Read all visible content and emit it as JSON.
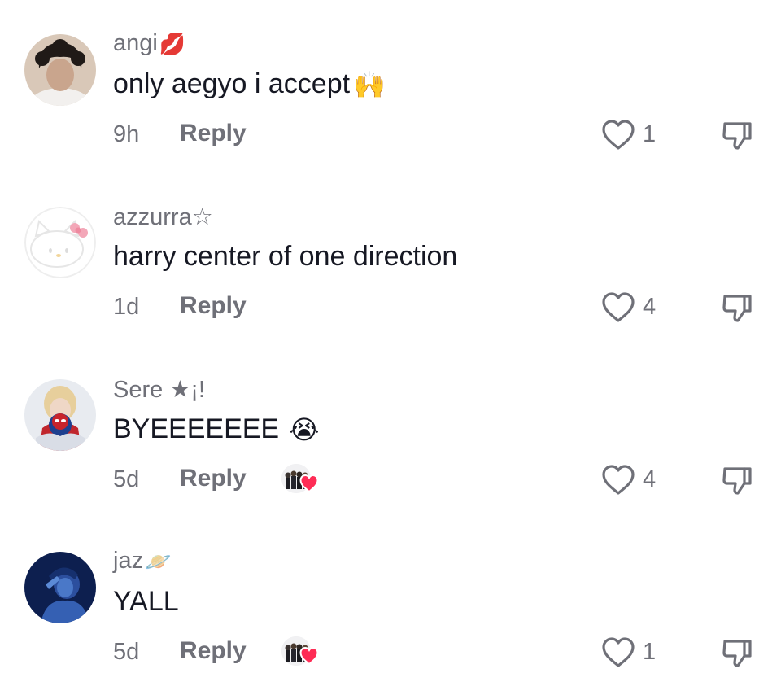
{
  "comments": [
    {
      "username": "angi",
      "username_emoji": "💋",
      "text": "only aegyo i accept",
      "text_emoji": "🙌",
      "time": "9h",
      "reply_label": "Reply",
      "likes": "1",
      "avatar_icon": "person-avatar-icon",
      "creator_liked": false
    },
    {
      "username": "azzurra☆",
      "username_emoji": "",
      "text": "harry center of one direction",
      "text_emoji": "",
      "time": "1d",
      "reply_label": "Reply",
      "likes": "4",
      "avatar_icon": "hello-kitty-avatar-icon",
      "creator_liked": false
    },
    {
      "username": "Sere ★¡!",
      "username_emoji": "",
      "text": "BYEEEEEEE",
      "text_emoji": "😭",
      "time": "5d",
      "reply_label": "Reply",
      "likes": "4",
      "avatar_icon": "person-with-plush-avatar-icon",
      "creator_liked": true
    },
    {
      "username": "jaz",
      "username_emoji": "🪐",
      "text": "YALL",
      "text_emoji": "",
      "time": "5d",
      "reply_label": "Reply",
      "likes": "1",
      "avatar_icon": "blue-photo-avatar-icon",
      "creator_liked": true
    }
  ],
  "colors": {
    "secondary_text": "#6f7078",
    "primary_text": "#161823",
    "creator_heart": "#fe2c55"
  }
}
